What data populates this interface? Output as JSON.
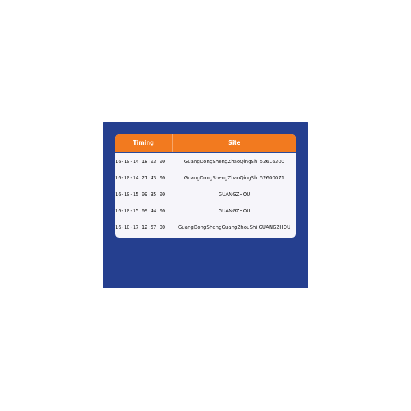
{
  "table": {
    "columns": [
      "Timing",
      "Site"
    ],
    "rows": [
      {
        "timing": "16-10-14  18:03:00",
        "site": "GuangDongShengZhaoQingShi 52616300"
      },
      {
        "timing": "16-10-14  21:43:00",
        "site": "GuangDongShengZhaoQingShi 52600071"
      },
      {
        "timing": "16-10-15  09:35:00",
        "site": "GUANGZHOU"
      },
      {
        "timing": "16-10-15  09:44:00",
        "site": "GUANGZHOU"
      },
      {
        "timing": "16-10-17  12:57:00",
        "site": "GuangDongShengGuangZhouShi GUANGZHOU"
      }
    ]
  },
  "colors": {
    "panel_background": "#253f8f",
    "header_background": "#f27a1f",
    "table_background": "#f6f5fa"
  }
}
